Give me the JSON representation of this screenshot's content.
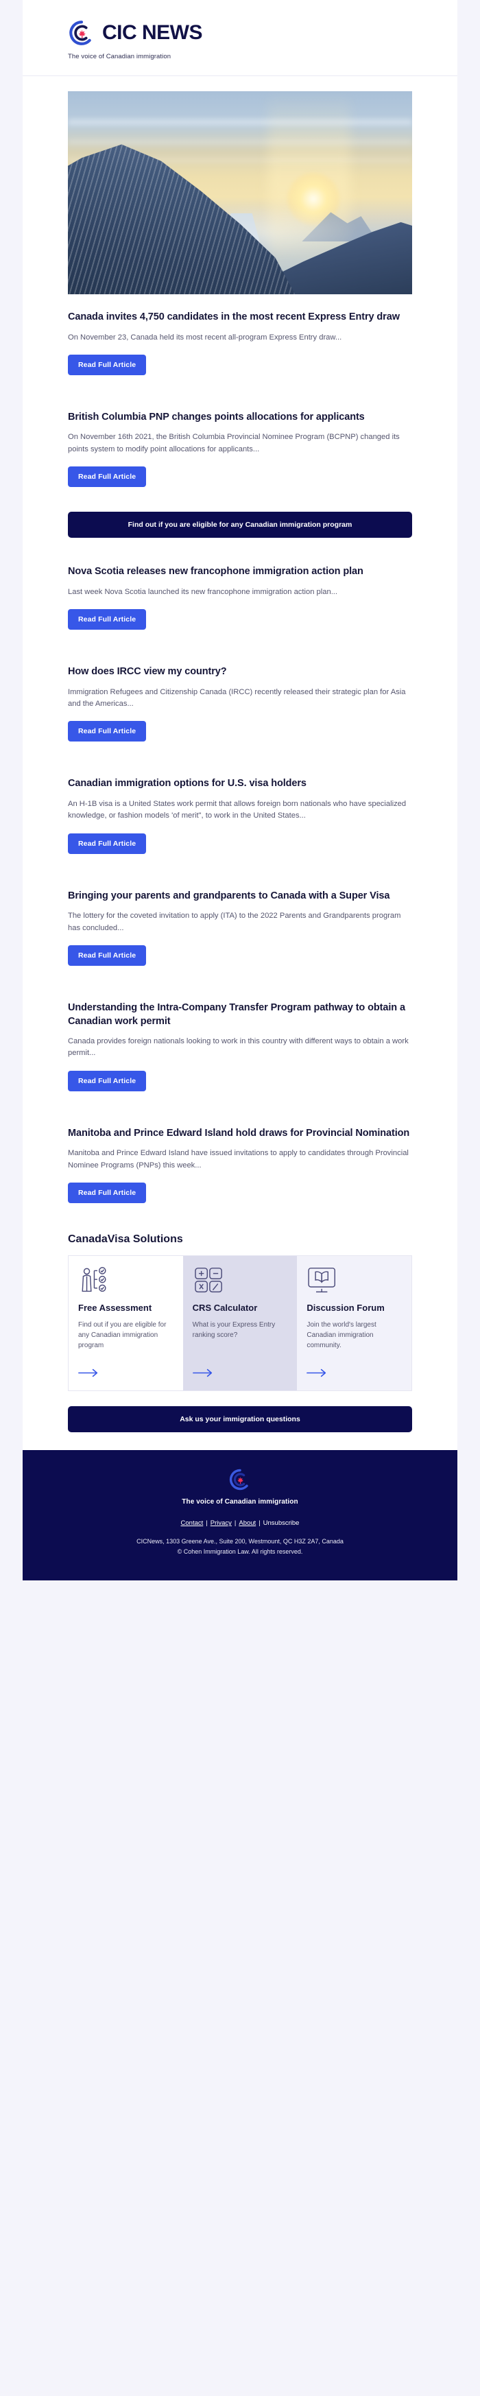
{
  "brand": {
    "name": "CIC NEWS",
    "tagline": "The voice of Canadian immigration",
    "logo_icon": "cic-circular-c-maple-leaf-logo",
    "accent_blue": "#3757e8",
    "navy": "#0c0c50",
    "maple_red": "#ef2f55"
  },
  "hero": {
    "alt": "snowy evergreen forest valley with river at golden sunrise"
  },
  "read_more_label": "Read Full Article",
  "articles": [
    {
      "title": "Canada invites 4,750 candidates in the most recent Express Entry draw",
      "excerpt": "On November 23, Canada held its most recent all-program Express Entry draw...",
      "button": "Read Full Article"
    },
    {
      "title": "British Columbia PNP changes points allocations for applicants",
      "excerpt": "On November 16th 2021, the British Columbia Provincial Nominee Program (BCPNP) changed its points system to modify point allocations for applicants...",
      "button": "Read Full Article"
    },
    {
      "title": "Nova Scotia releases new francophone immigration action plan",
      "excerpt": "Last week Nova Scotia launched its new francophone immigration action plan...",
      "button": "Read Full Article"
    },
    {
      "title": "How does IRCC view my country?",
      "excerpt": "Immigration Refugees and Citizenship Canada (IRCC) recently released their strategic plan for Asia and the Americas...",
      "button": "Read Full Article"
    },
    {
      "title": "Canadian immigration options for U.S. visa holders",
      "excerpt": "An H-1B visa is a United States work permit that allows foreign born nationals who have specialized knowledge, or fashion models 'of merit\", to work in the United States...",
      "button": "Read Full Article"
    },
    {
      "title": "Bringing your parents and grandparents to Canada with a Super Visa",
      "excerpt": "The lottery for the coveted invitation to apply (ITA) to the 2022 Parents and Grandparents program has concluded...",
      "button": "Read Full Article"
    },
    {
      "title": "Understanding the Intra-Company Transfer Program pathway to obtain a Canadian work permit",
      "excerpt": "Canada provides foreign nationals looking to work in this country with different ways to obtain a work permit...",
      "button": "Read Full Article"
    },
    {
      "title": "Manitoba and Prince Edward Island hold draws for Provincial Nomination",
      "excerpt": "Manitoba and Prince Edward Island have issued invitations to apply to candidates through Provincial Nominee Programs (PNPs) this week...",
      "button": "Read Full Article"
    }
  ],
  "eligibility_cta": "Find out if you are eligible for any Canadian immigration program",
  "ask_cta": "Ask us your immigration questions",
  "solutions": {
    "heading": "CanadaVisa Solutions",
    "cards": [
      {
        "title": "Free Assessment",
        "desc": "Find out if you are eligible for any Canadian immigration program",
        "icon": "person-checklist-icon",
        "arrow": "arrow-right-icon"
      },
      {
        "title": "CRS Calculator",
        "desc": "What is your Express Entry ranking score?",
        "icon": "calculator-icon",
        "arrow": "arrow-right-icon"
      },
      {
        "title": "Discussion Forum",
        "desc": "Join the world's largest Canadian immigration community.",
        "icon": "monitor-book-icon",
        "arrow": "arrow-right-icon"
      }
    ]
  },
  "footer": {
    "tagline": "The voice of Canadian immigration",
    "logo_icon": "cic-circular-c-maple-leaf-logo",
    "links": [
      {
        "label": "Contact",
        "underlined": true
      },
      {
        "label": "Privacy",
        "underlined": true
      },
      {
        "label": "About",
        "underlined": true
      },
      {
        "label": "Unsubscribe",
        "underlined": false
      }
    ],
    "separator": "|",
    "address": "CICNews, 1303 Greene Ave., Suite 200, Westmount, QC H3Z 2A7, Canada",
    "copyright": "© Cohen Immigration Law. All rights reserved."
  }
}
